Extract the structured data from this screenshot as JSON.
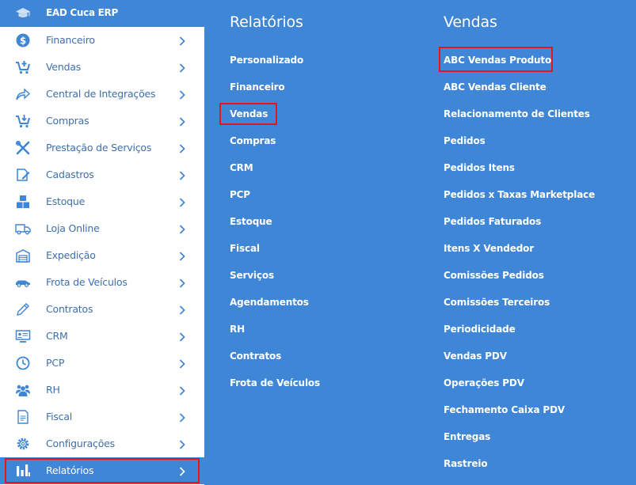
{
  "header": {
    "title": "EAD Cuca ERP",
    "icon": "graduation-cap-icon"
  },
  "sidebar": {
    "items": [
      {
        "label": "Financeiro",
        "icon": "dollar-circle-icon"
      },
      {
        "label": "Vendas",
        "icon": "cart-plus-icon"
      },
      {
        "label": "Central de Integrações",
        "icon": "share-arrow-icon"
      },
      {
        "label": "Compras",
        "icon": "cart-download-icon"
      },
      {
        "label": "Prestação de Serviços",
        "icon": "tools-icon"
      },
      {
        "label": "Cadastros",
        "icon": "edit-document-icon"
      },
      {
        "label": "Estoque",
        "icon": "boxes-icon"
      },
      {
        "label": "Loja Online",
        "icon": "delivery-truck-icon"
      },
      {
        "label": "Expedição",
        "icon": "warehouse-icon"
      },
      {
        "label": "Frota de Veículos",
        "icon": "car-icon"
      },
      {
        "label": "Contratos",
        "icon": "pen-icon"
      },
      {
        "label": "CRM",
        "icon": "monitor-contact-icon"
      },
      {
        "label": "PCP",
        "icon": "clock-icon"
      },
      {
        "label": "RH",
        "icon": "people-icon"
      },
      {
        "label": "Fiscal",
        "icon": "document-icon"
      },
      {
        "label": "Configurações",
        "icon": "gear-icon"
      },
      {
        "label": "Relatórios",
        "icon": "bar-chart-icon"
      }
    ],
    "active_index": 16
  },
  "panel": {
    "relatorios": {
      "title": "Relatórios",
      "items": [
        "Personalizado",
        "Financeiro",
        "Vendas",
        "Compras",
        "CRM",
        "PCP",
        "Estoque",
        "Fiscal",
        "Serviços",
        "Agendamentos",
        "RH",
        "Contratos",
        "Frota de Veículos"
      ],
      "highlighted_index": 2
    },
    "vendas": {
      "title": "Vendas",
      "items": [
        "ABC Vendas Produto",
        "ABC Vendas Cliente",
        "Relacionamento de Clientes",
        "Pedidos",
        "Pedidos Itens",
        "Pedidos x Taxas Marketplace",
        "Pedidos Faturados",
        "Itens X Vendedor",
        "Comissões Pedidos",
        "Comissões Terceiros",
        "Periodicidade",
        "Vendas PDV",
        "Operações PDV",
        "Fechamento Caixa PDV",
        "Entregas",
        "Rastreio"
      ],
      "highlighted_index": 0
    }
  },
  "colors": {
    "accent": "#3f86d6",
    "label": "#3f6fa8",
    "highlight": "#e8141b"
  }
}
